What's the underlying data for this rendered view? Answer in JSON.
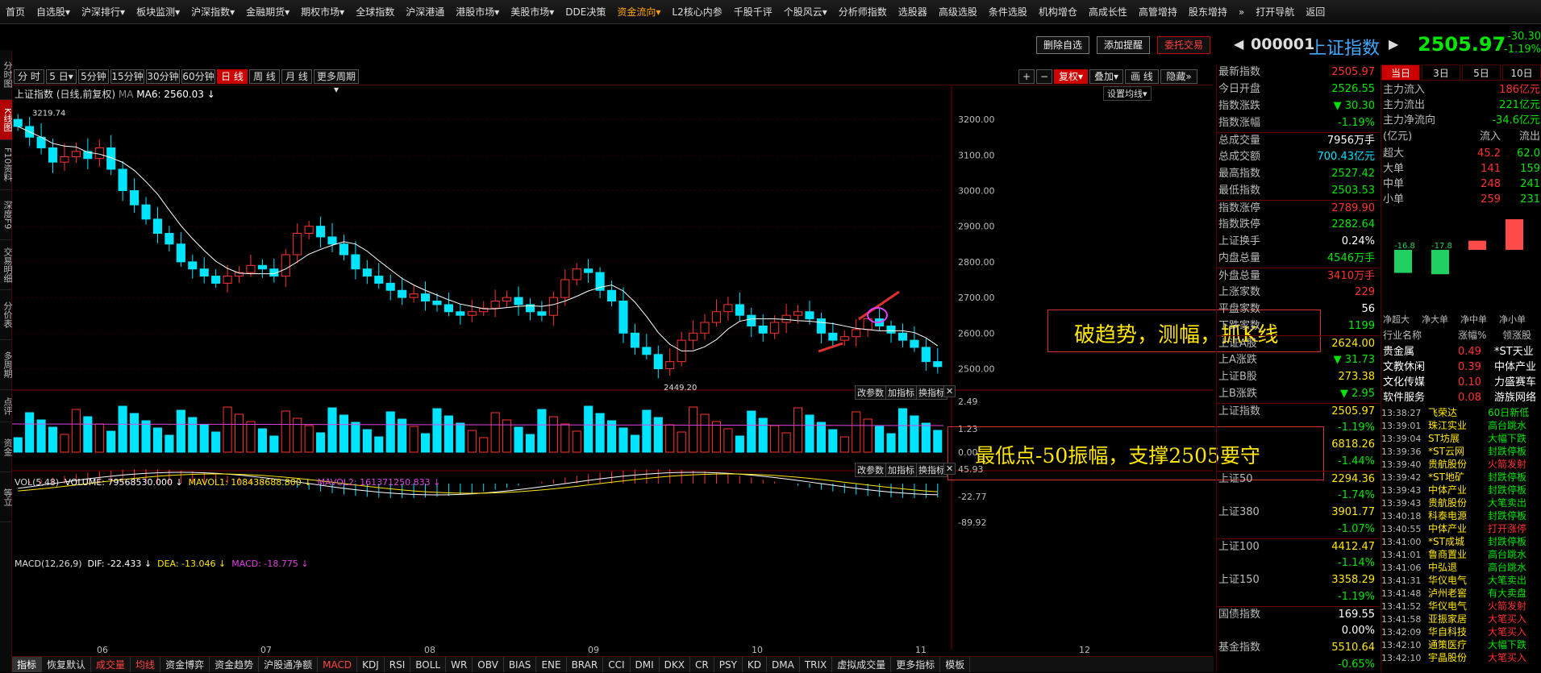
{
  "nav": [
    "首页",
    "自选股▾",
    "沪深排行▾",
    "板块监测▾",
    "沪深指数▾",
    "金融期货▾",
    "期权市场▾",
    "全球指数",
    "沪深港通",
    "港股市场▾",
    "美股市场▾",
    "DDE决策",
    "资金流向▾",
    "L2核心内参",
    "千股千评",
    "个股风云▾",
    "分析师指数",
    "选股器",
    "高级选股",
    "条件选股",
    "机构增仓",
    "高成长性",
    "高管增持",
    "股东增持",
    "»",
    "打开导航",
    "返回"
  ],
  "left_tabs": [
    "分时图",
    "K线图",
    "F10资料",
    "深度F9",
    "交易明细",
    "分价表",
    "多周期",
    "点评",
    "资金",
    "等立"
  ],
  "action_buttons": {
    "del": "删除自选",
    "add": "添加提醒",
    "trade": "委托交易"
  },
  "stock": {
    "code": "000001",
    "name": "上证指数",
    "price": "2505.97",
    "change": "-30.30",
    "pct": "-1.19%"
  },
  "periods": [
    "分 时",
    "5 日▾",
    "5分钟",
    "15分钟",
    "30分钟",
    "60分钟",
    "日 线",
    "周 线",
    "月 线",
    "更多周期▾"
  ],
  "tools": [
    "+",
    "−",
    "复权▾",
    "叠加▾",
    "画 线",
    "隐藏»"
  ],
  "chart_header": {
    "name": "上证指数",
    "mode": "(日线,前复权)",
    "ma_label": "MA",
    "ma6": "MA6: 2560.03 ↓",
    "settings": "设置均线▾"
  },
  "vol_header": {
    "vol": "VOL(5,48)",
    "volume": "VOLUME: 79568530.000 ↓",
    "mavol1": "MAVOL1: 108438688.800 ↓",
    "mavol2": "MAVOL2: 161371250.833 ↓"
  },
  "macd_header": {
    "name": "MACD(12,26,9)",
    "dif": "DIF: -22.433 ↓",
    "dea": "DEA: -13.046 ↓",
    "macd": "MACD: -18.775 ↓"
  },
  "sub_btns": [
    "改参数",
    "加指标",
    "换指标",
    "✕"
  ],
  "price_axis": [
    "3200.00",
    "3100.00",
    "3000.00",
    "2900.00",
    "2800.00",
    "2700.00",
    "2600.00",
    "2500.00"
  ],
  "vol_axis": [
    "2.49",
    "1.23",
    "0.00"
  ],
  "macd_axis": [
    "45.93",
    "-22.77",
    "-89.92"
  ],
  "months": [
    "06",
    "07",
    "08",
    "09",
    "10",
    "11",
    "12"
  ],
  "annotations": {
    "high": "3219.74",
    "low": "2449.20",
    "a1": "破趋势，测幅，抓K线",
    "a2": "最低点-50振幅，支撑2505要守"
  },
  "quote": [
    [
      "最新指数",
      "2505.97",
      "#ff3030"
    ],
    [
      "今日开盘",
      "2526.55",
      "#00e600"
    ],
    [
      "指数涨跌",
      "▼ 30.30",
      "#00e600"
    ],
    [
      "指数涨幅",
      "-1.19%",
      "#00e600"
    ],
    [
      "总成交量",
      "7956万手",
      "#fff"
    ],
    [
      "总成交额",
      "700.43亿元",
      "#00e5ff"
    ],
    [
      "最高指数",
      "2527.42",
      "#00e600"
    ],
    [
      "最低指数",
      "2503.53",
      "#00e600"
    ],
    [
      "指数涨停",
      "2789.90",
      "#ff3030"
    ],
    [
      "指数跌停",
      "2282.64",
      "#00e600"
    ],
    [
      "上证换手",
      "0.24%",
      "#fff"
    ],
    [
      "内盘总量",
      "4546万手",
      "#00e600"
    ],
    [
      "外盘总量",
      "3410万手",
      "#ff3030"
    ],
    [
      "上涨家数",
      "229",
      "#ff3030"
    ],
    [
      "平盘家数",
      "56",
      "#fff"
    ],
    [
      "下跌家数",
      "1199",
      "#00e600"
    ],
    [
      "上证A股",
      "2624.00",
      "#ffe600"
    ],
    [
      "上A涨跌",
      "▼ 31.73",
      "#00e600"
    ],
    [
      "上证B股",
      "273.38",
      "#ffe600"
    ],
    [
      "上B涨跌",
      "▼ 2.95",
      "#00e600"
    ],
    [
      "上证指数",
      "2505.97",
      "#ffe600"
    ],
    [
      "",
      "-1.19%",
      "#00e600"
    ],
    [
      "",
      "6818.26",
      "#ffe600"
    ],
    [
      "",
      "-1.44%",
      "#00e600"
    ],
    [
      "上证50",
      "2294.36",
      "#ffe600"
    ],
    [
      "",
      "-1.74%",
      "#00e600"
    ],
    [
      "上证380",
      "3901.77",
      "#ffe600"
    ],
    [
      "",
      "-1.07%",
      "#00e600"
    ],
    [
      "上证100",
      "4412.47",
      "#ffe600"
    ],
    [
      "",
      "-1.14%",
      "#00e600"
    ],
    [
      "上证150",
      "3358.29",
      "#ffe600"
    ],
    [
      "",
      "-1.19%",
      "#00e600"
    ],
    [
      "国债指数",
      "169.55",
      "#fff"
    ],
    [
      "",
      "0.00%",
      "#fff"
    ],
    [
      "基金指数",
      "5510.64",
      "#ffe600"
    ],
    [
      "",
      "-0.65%",
      "#00e600"
    ]
  ],
  "flow_tabs": [
    "当日",
    "3日",
    "5日",
    "10日"
  ],
  "flow_main": [
    [
      "主力流入",
      "186亿元",
      "#ff3030"
    ],
    [
      "主力流出",
      "221亿元",
      "#00e600"
    ],
    [
      "主力净流向",
      "-34.6亿元",
      "#00e600"
    ]
  ],
  "flow_head": [
    "(亿元)",
    "流入",
    "流出"
  ],
  "flow_rows": [
    [
      "超大",
      "45.2",
      "62.0"
    ],
    [
      "大单",
      "141",
      "159"
    ],
    [
      "中单",
      "248",
      "241"
    ],
    [
      "小单",
      "259",
      "231"
    ]
  ],
  "flow_bars": {
    "labels": [
      "净超大",
      "净大单",
      "净中单",
      "净小单"
    ],
    "values": [
      -16.8,
      -17.8,
      6.7,
      27.9
    ],
    "texts": [
      "-16.8",
      "-17.8",
      "6.70",
      "27.9"
    ]
  },
  "sector_head": [
    "行业名称",
    "涨幅%",
    "领涨股"
  ],
  "sectors": [
    [
      "贵金属",
      "0.49",
      "*ST天业"
    ],
    [
      "文教休闲",
      "0.39",
      "中体产业"
    ],
    [
      "文化传媒",
      "0.10",
      "力盛赛车"
    ],
    [
      "软件服务",
      "0.08",
      "游族网络"
    ]
  ],
  "ticker": [
    [
      "13:38:27",
      "飞荣达",
      "60日新低"
    ],
    [
      "13:39:01",
      "珠江实业",
      "高台跳水"
    ],
    [
      "13:39:04",
      "ST坊展",
      "大幅下跌"
    ],
    [
      "13:39:36",
      "*ST云网",
      "封跌停板"
    ],
    [
      "13:39:40",
      "贵航股份",
      "火箭发射"
    ],
    [
      "13:39:42",
      "*ST地矿",
      "封跌停板"
    ],
    [
      "13:39:43",
      "中体产业",
      "封跌停板"
    ],
    [
      "13:39:43",
      "贵航股份",
      "大笔卖出"
    ],
    [
      "13:40:18",
      "科泰电源",
      "封跌停板"
    ],
    [
      "13:40:55",
      "中体产业",
      "打开涨停"
    ],
    [
      "13:41:00",
      "*ST成城",
      "封跌停板"
    ],
    [
      "13:41:01",
      "鲁商置业",
      "高台跳水"
    ],
    [
      "13:41:06",
      "中弘退",
      "高台跳水"
    ],
    [
      "13:41:31",
      "华仪电气",
      "大笔卖出"
    ],
    [
      "13:41:48",
      "泸州老窖",
      "有大卖盘"
    ],
    [
      "13:41:52",
      "华仪电气",
      "火箭发射"
    ],
    [
      "13:41:58",
      "亚振家居",
      "大笔买入"
    ],
    [
      "13:42:09",
      "华自科技",
      "大笔买入"
    ],
    [
      "13:42:10",
      "通策医疗",
      "大幅下跌"
    ],
    [
      "13:42:10",
      "宇晶股份",
      "大笔买入"
    ]
  ],
  "bottom": [
    "指标",
    "恢复默认",
    "成交量",
    "均线",
    "资金博弈",
    "资金趋势",
    "沪股通净额",
    "MACD",
    "KDJ",
    "RSI",
    "BOLL",
    "WR",
    "OBV",
    "BIAS",
    "ENE",
    "BRAR",
    "CCI",
    "DMI",
    "DKX",
    "CR",
    "PSY",
    "KD",
    "DMA",
    "TRIX",
    "虚拟成交量",
    "更多指标",
    "模板"
  ],
  "chart_data": {
    "type": "candlestick",
    "series_name": "上证指数",
    "annotated_high": 3219.74,
    "annotated_low": 2449.2,
    "last_close": 2505.97,
    "ma6_last": 2560.03,
    "closes": [
      3180,
      3150,
      3120,
      3080,
      3095,
      3110,
      3090,
      3120,
      3060,
      3000,
      2960,
      2920,
      2880,
      2850,
      2800,
      2780,
      2760,
      2740,
      2760,
      2770,
      2790,
      2780,
      2760,
      2820,
      2880,
      2900,
      2870,
      2850,
      2820,
      2780,
      2760,
      2740,
      2720,
      2700,
      2710,
      2690,
      2680,
      2660,
      2650,
      2660,
      2670,
      2690,
      2700,
      2680,
      2660,
      2650,
      2700,
      2750,
      2780,
      2770,
      2720,
      2690,
      2600,
      2560,
      2540,
      2500,
      2520,
      2580,
      2600,
      2630,
      2660,
      2680,
      2650,
      2620,
      2600,
      2630,
      2650,
      2660,
      2640,
      2600,
      2580,
      2590,
      2610,
      2640,
      2620,
      2600,
      2580,
      2560,
      2520,
      2505.97
    ]
  }
}
